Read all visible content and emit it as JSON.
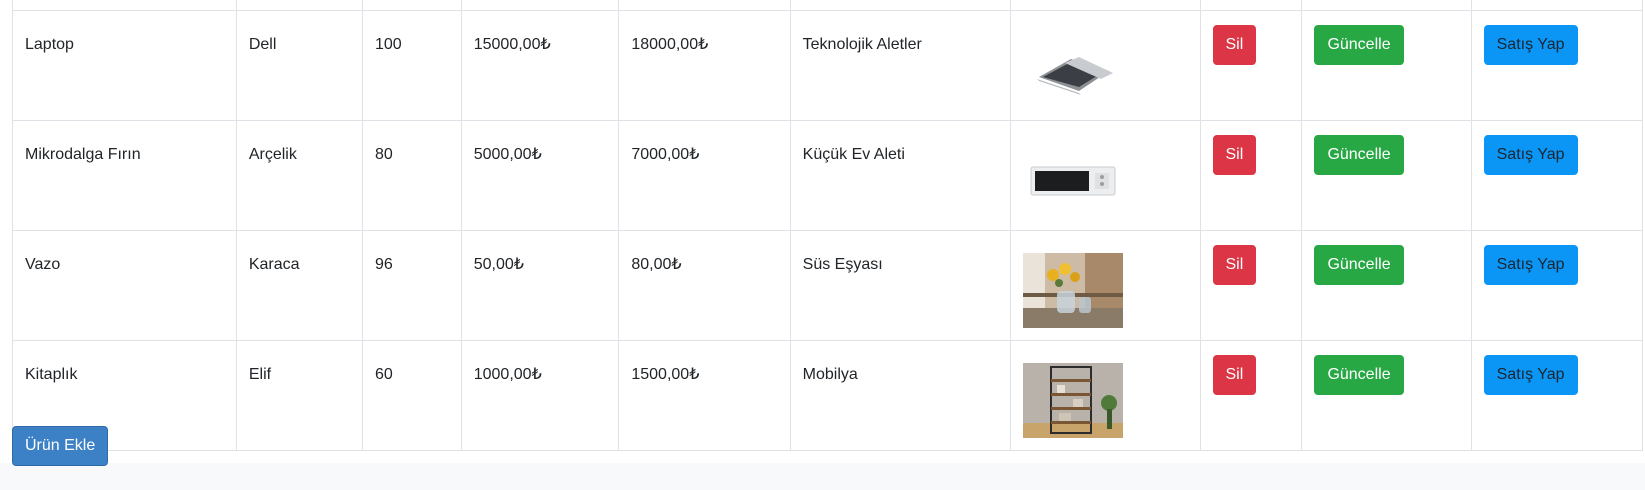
{
  "products": [
    {
      "name": "Laptop",
      "brand": "Dell",
      "stock": "100",
      "purchase_price": "15000,00₺",
      "sale_price": "18000,00₺",
      "category": "Teknolojik Aletler",
      "image": "laptop"
    },
    {
      "name": "Mikrodalga Fırın",
      "brand": "Arçelik",
      "stock": "80",
      "purchase_price": "5000,00₺",
      "sale_price": "7000,00₺",
      "category": "Küçük Ev Aleti",
      "image": "microwave"
    },
    {
      "name": "Vazo",
      "brand": "Karaca",
      "stock": "96",
      "purchase_price": "50,00₺",
      "sale_price": "80,00₺",
      "category": "Süs Eşyası",
      "image": "vase"
    },
    {
      "name": "Kitaplık",
      "brand": "Elif",
      "stock": "60",
      "purchase_price": "1000,00₺",
      "sale_price": "1500,00₺",
      "category": "Mobilya",
      "image": "bookshelf"
    }
  ],
  "actions": {
    "delete": "Sil",
    "update": "Güncelle",
    "sell": "Satış Yap"
  },
  "add_button": "Ürün Ekle",
  "colors": {
    "delete": "#dc3545",
    "update": "#28a745",
    "sell": "#0b96f5",
    "add": "#3c80c5"
  }
}
